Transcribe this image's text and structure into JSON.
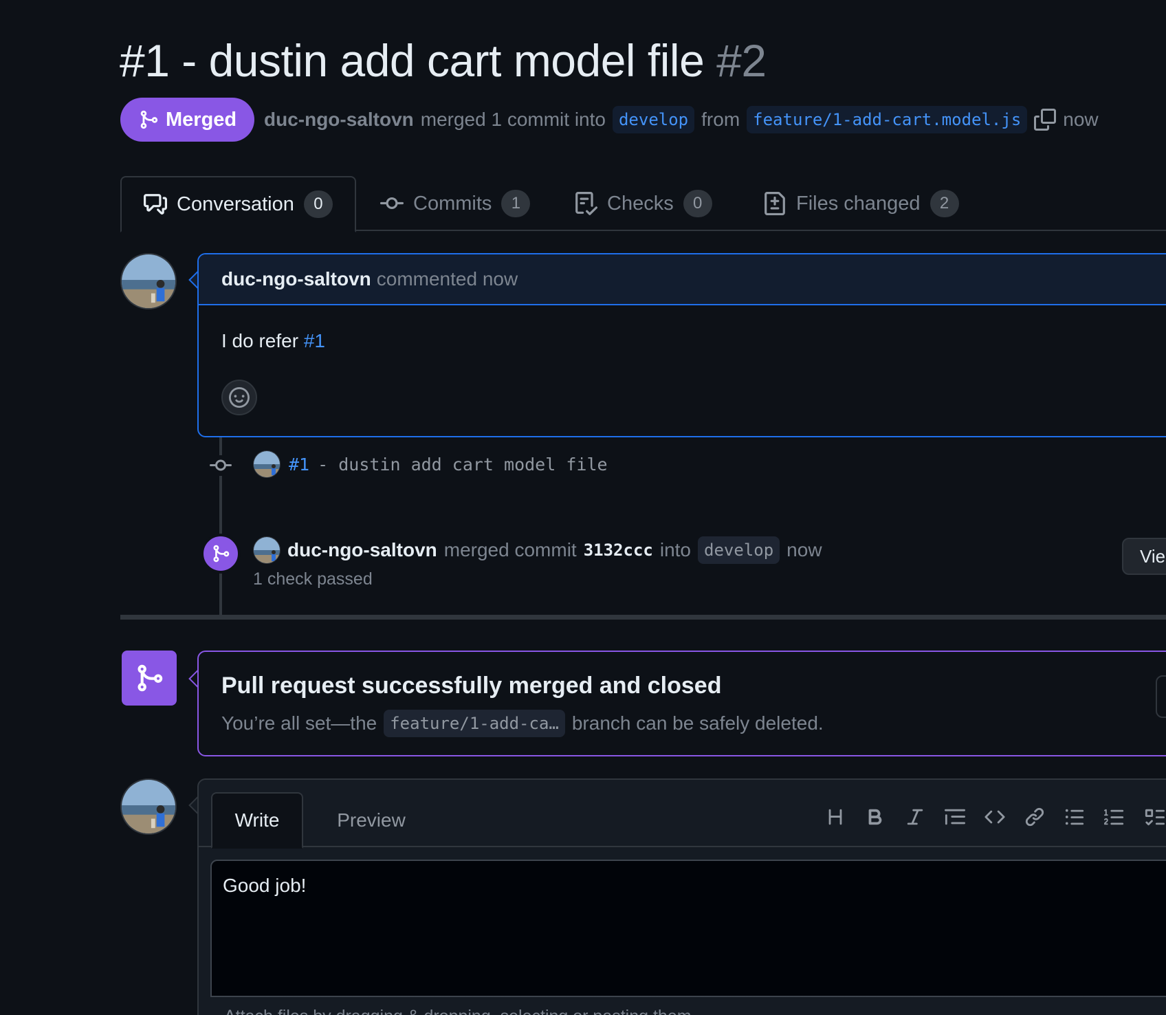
{
  "title": {
    "text": "#1 - dustin add cart model file",
    "number": "#2"
  },
  "state": {
    "label": "Merged",
    "color": "#8957e5"
  },
  "meta": {
    "author": "duc-ngo-saltovn",
    "action": "merged 1 commit into",
    "base_branch": "develop",
    "from": "from",
    "head_branch": "feature/1-add-cart.model.js",
    "time": "now"
  },
  "tabs": [
    {
      "label": "Conversation",
      "count": "0",
      "icon": "comment-discussion-icon"
    },
    {
      "label": "Commits",
      "count": "1",
      "icon": "git-commit-icon"
    },
    {
      "label": "Checks",
      "count": "0",
      "icon": "checklist-icon"
    },
    {
      "label": "Files changed",
      "count": "2",
      "icon": "file-diff-icon"
    }
  ],
  "comment": {
    "author": "duc-ngo-saltovn",
    "action": "commented now",
    "body_text": "I do refer",
    "body_ref": "#1"
  },
  "timeline": {
    "commit": {
      "link": "#1",
      "message": "- dustin add cart model file"
    },
    "merge": {
      "author": "duc-ngo-saltovn",
      "action": "merged commit",
      "sha": "3132ccc",
      "into": "into",
      "branch": "develop",
      "time": "now",
      "checks": "1 check passed",
      "button_label": "Vie"
    }
  },
  "merged_box": {
    "title": "Pull request successfully merged and closed",
    "sub_before": "You’re all set—the",
    "branch": "feature/1-add-ca…",
    "sub_after": "branch can be safely deleted."
  },
  "editor": {
    "write_tab": "Write",
    "preview_tab": "Preview",
    "toolbar": [
      "heading-icon",
      "bold-icon",
      "italic-icon",
      "quote-icon",
      "code-icon",
      "link-icon",
      "unordered-list-icon",
      "ordered-list-icon",
      "task-list-icon"
    ],
    "text": "Good job!",
    "attach_hint": "Attach files by dragging & dropping, selecting or pasting them."
  },
  "colors": {
    "accent_blue": "#4493f8",
    "merged_purple": "#8957e5",
    "background": "#0d1117"
  }
}
